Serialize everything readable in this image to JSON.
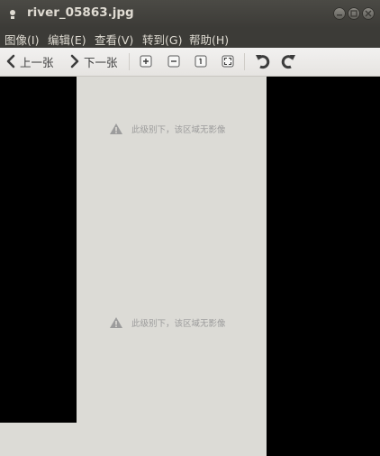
{
  "window": {
    "title": "river_05863.jpg",
    "icons": {
      "app": "image-viewer-icon",
      "minimize": "minimize-icon",
      "maximize": "maximize-icon",
      "close": "close-icon"
    }
  },
  "menu": {
    "items": [
      {
        "label": "图像(I)"
      },
      {
        "label": "编辑(E)"
      },
      {
        "label": "查看(V)"
      },
      {
        "label": "转到(G)"
      },
      {
        "label": "帮助(H)"
      }
    ]
  },
  "toolbar": {
    "prev_label": "上一张",
    "next_label": "下一张",
    "icons": [
      "zoom-in-icon",
      "zoom-out-icon",
      "zoom-normal-icon",
      "zoom-fit-icon",
      "rotate-left-icon",
      "rotate-right-icon"
    ]
  },
  "canvas": {
    "notices": [
      {
        "text": "此级别下，该区域无影像"
      },
      {
        "text": "此级别下，该区域无影像"
      }
    ],
    "colors": {
      "background": "#000000",
      "tile": "#dcdbd6",
      "notice_text": "#9c9c9c"
    }
  }
}
